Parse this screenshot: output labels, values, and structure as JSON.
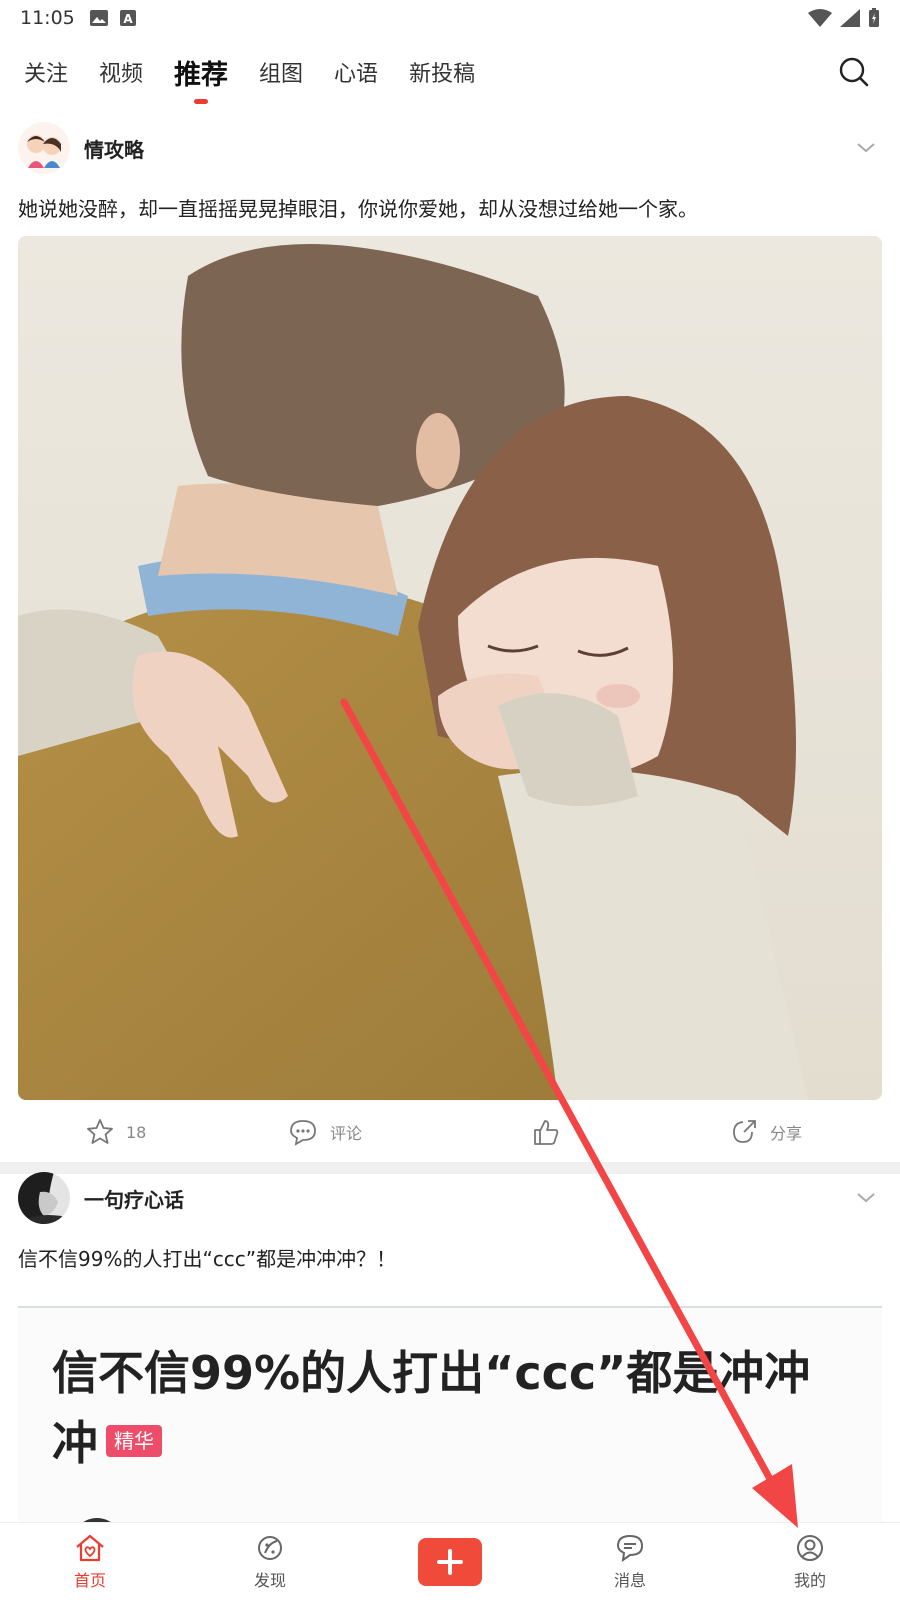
{
  "status_bar": {
    "time": "11:05"
  },
  "tabs": [
    {
      "label": "关注"
    },
    {
      "label": "视频"
    },
    {
      "label": "推荐"
    },
    {
      "label": "组图"
    },
    {
      "label": "心语"
    },
    {
      "label": "新投稿"
    }
  ],
  "active_tab": "推荐",
  "posts": [
    {
      "author": "情攻略",
      "text": "她说她没醉，却一直摇摇晃晃掉眼泪，你说你爱她，却从没想过给她一个家。",
      "actions": {
        "favorite_count": "18",
        "comment_label": "评论",
        "share_label": "分享"
      }
    },
    {
      "author": "一句疗心话",
      "text": "信不信99%的人打出“ccc”都是冲冲冲？！",
      "banner_title": "信不信99%的人打出“ccc”都是冲冲冲",
      "banner_badge": "精华"
    }
  ],
  "bottom_nav": [
    {
      "label": "首页",
      "icon": "home-icon"
    },
    {
      "label": "发现",
      "icon": "discover-icon"
    },
    {
      "label": "",
      "icon": "plus-icon"
    },
    {
      "label": "消息",
      "icon": "message-icon"
    },
    {
      "label": "我的",
      "icon": "profile-icon"
    }
  ],
  "colors": {
    "accent": "#ee3b30",
    "arrow": "#f24545",
    "badge": "#ee4d6a"
  }
}
